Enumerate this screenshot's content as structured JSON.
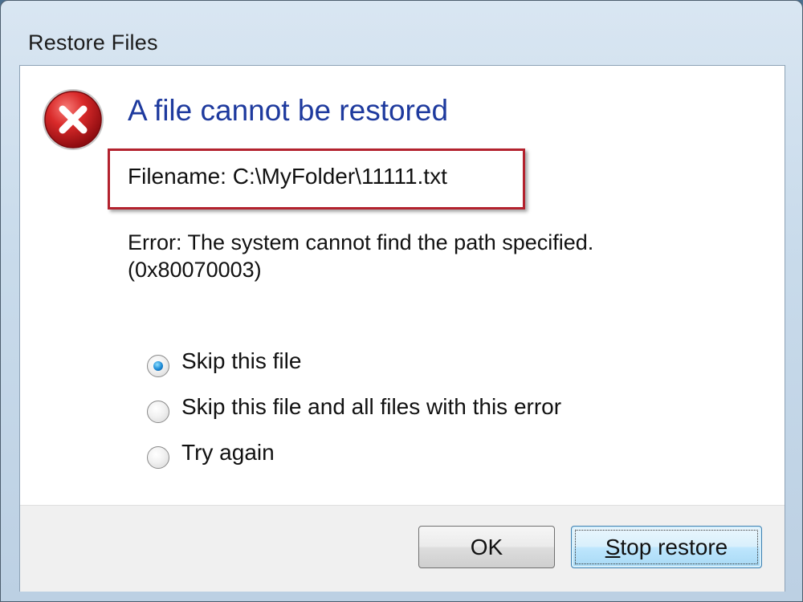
{
  "window": {
    "title": "Restore Files"
  },
  "dialog": {
    "icon": "error-icon",
    "main_instruction": "A file cannot be restored",
    "filename": "Filename: C:\\MyFolder\\11111.txt",
    "error_line1": "Error: The system cannot find the path specified.",
    "error_line2": "(0x80070003)"
  },
  "options": [
    {
      "label": "Skip this file",
      "checked": true
    },
    {
      "label": "Skip this file and all files with this error",
      "checked": false
    },
    {
      "label": "Try again",
      "checked": false
    }
  ],
  "buttons": {
    "ok_label": "OK",
    "stop_accel": "S",
    "stop_rest": "top restore"
  },
  "colors": {
    "instruction": "#1e3a9e",
    "highlight_border": "#b3222e",
    "error_icon": "#c8161d"
  }
}
